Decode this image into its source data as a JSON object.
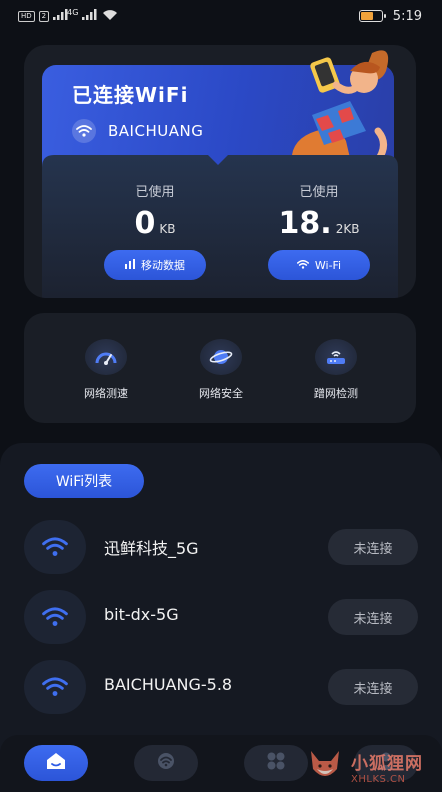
{
  "status_bar": {
    "left_chips": [
      "HD",
      "2"
    ],
    "signal_label": "4G",
    "time": "5:19",
    "battery_level": 0.55,
    "battery_color": "#f0a23b"
  },
  "connection": {
    "title": "已连接WiFi",
    "ssid": "BAICHUANG"
  },
  "usage": {
    "mobile": {
      "label": "已使用",
      "value": "0",
      "unit": "KB",
      "button": "移动数据"
    },
    "wifi": {
      "label": "已使用",
      "value": "18.",
      "unit": "2KB",
      "button": "Wi-Fi"
    }
  },
  "tools": [
    {
      "label": "网络测速",
      "icon": "speed-gauge-icon"
    },
    {
      "label": "网络安全",
      "icon": "planet-shield-icon"
    },
    {
      "label": "蹭网检测",
      "icon": "router-detect-icon"
    }
  ],
  "wifi_list": {
    "title": "WiFi列表",
    "items": [
      {
        "name": "迅鲜科技_5G",
        "status": "未连接"
      },
      {
        "name": "bit-dx-5G",
        "status": "未连接"
      },
      {
        "name": "BAICHUANG-5.8",
        "status": "未连接"
      }
    ]
  },
  "nav": {
    "items": [
      "home-icon",
      "wifi-icon",
      "apps-grid-icon",
      "profile-icon"
    ],
    "active_index": 0
  },
  "watermark": {
    "cn": "小狐狸网",
    "en": "XHLKS.CN"
  },
  "colors": {
    "accent": "#2f5de6",
    "background": "#0d1016",
    "card": "#1a1e26"
  }
}
